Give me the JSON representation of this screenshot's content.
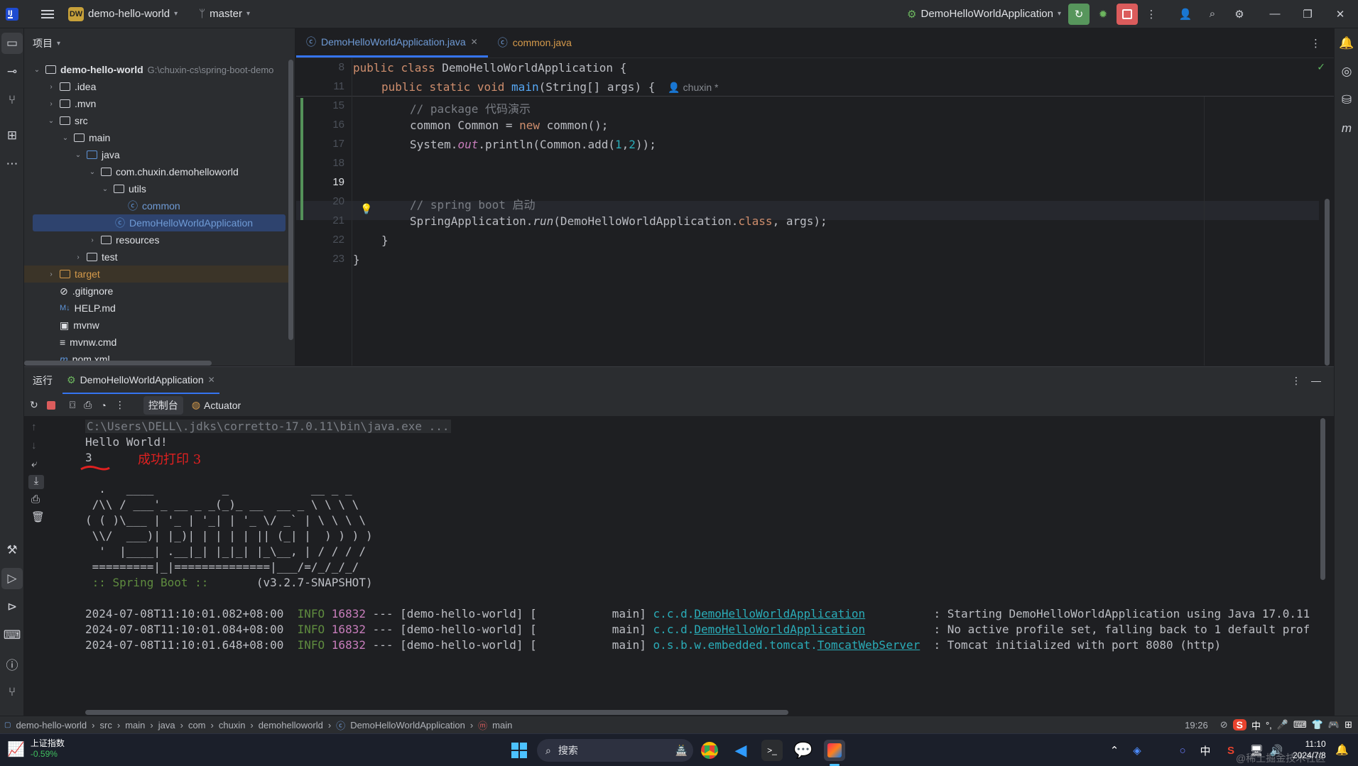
{
  "titlebar": {
    "project_badge": "DW",
    "project_name": "demo-hello-world",
    "branch": "master",
    "run_config": "DemoHelloWorldApplication"
  },
  "project_panel": {
    "title": "项目",
    "root_name": "demo-hello-world",
    "root_path": "G:\\chuxin-cs\\spring-boot-demo",
    "nodes": [
      ".idea",
      ".mvn",
      "src",
      "main",
      "java",
      "com.chuxin.demohelloworld",
      "utils",
      "common",
      "DemoHelloWorldApplication",
      "resources",
      "test",
      "target",
      ".gitignore",
      "HELP.md",
      "mvnw",
      "mvnw.cmd",
      "pom.xml"
    ]
  },
  "editor": {
    "tabs": [
      "DemoHelloWorldApplication.java",
      "common.java"
    ],
    "line_numbers": [
      "8",
      "11",
      "15",
      "16",
      "17",
      "18",
      "19",
      "20",
      "21",
      "22",
      "23"
    ],
    "lines": {
      "l8": [
        "public",
        " ",
        "class",
        " DemoHelloWorldApplication {"
      ],
      "l11": [
        "public",
        " ",
        "static",
        " ",
        "void",
        " ",
        "main",
        "(String[] args) {"
      ],
      "author": "chuxin *",
      "l15": "// package 代码演示",
      "l16": [
        "common Common = ",
        "new",
        " common();"
      ],
      "l17": [
        "System.",
        "out",
        ".println(Common.add(",
        "1",
        ",",
        "2",
        "));"
      ],
      "l19": "// spring boot 启动",
      "l20": [
        "SpringApplication.",
        "run",
        "(DemoHelloWorldApplication.",
        "class",
        ", args);"
      ],
      "l21": "}",
      "l22": "}"
    }
  },
  "run_panel": {
    "title": "运行",
    "config_tab": "DemoHelloWorldApplication",
    "tool_tabs": [
      "控制台",
      "Actuator"
    ],
    "console": {
      "cmd": "C:\\Users\\DELL\\.jdks\\corretto-17.0.11\\bin\\java.exe ...",
      "hello": "Hello World!",
      "three": "3",
      "annotation": "成功打印 3",
      "banner": [
        "  .   ____          _            __ _ _",
        " /\\\\ / ___'_ __ _ _(_)_ __  __ _ \\ \\ \\ \\",
        "( ( )\\___ | '_ | '_| | '_ \\/ _` | \\ \\ \\ \\",
        " \\\\/  ___)| |_)| | | | | || (_| |  ) ) ) )",
        "  '  |____| .__|_| |_|_| |_\\__, | / / / /",
        " =========|_|==============|___/=/_/_/_/"
      ],
      "spring_label": " :: Spring Boot ::",
      "spring_version": "       (v3.2.7-SNAPSHOT)",
      "logs": [
        {
          "ts": "2024-07-08T11:10:01.082+08:00",
          "level": "INFO",
          "pid": "16832",
          "mid": " --- [demo-hello-world] [           main] ",
          "pkg": "c.c.d.",
          "cls": "DemoHelloWorldApplication",
          "msg": ": Starting DemoHelloWorldApplication using Java 17.0.11"
        },
        {
          "ts": "2024-07-08T11:10:01.084+08:00",
          "level": "INFO",
          "pid": "16832",
          "mid": " --- [demo-hello-world] [           main] ",
          "pkg": "c.c.d.",
          "cls": "DemoHelloWorldApplication",
          "msg": ": No active profile set, falling back to 1 default prof"
        },
        {
          "ts": "2024-07-08T11:10:01.648+08:00",
          "level": "INFO",
          "pid": "16832",
          "mid": " --- [demo-hello-world] [           main] ",
          "pkg": "o.s.b.w.embedded.tomcat.",
          "cls": "TomcatWebServer",
          "msg": ": Tomcat initialized with port 8080 (http)"
        }
      ]
    }
  },
  "statusbar": {
    "crumbs": [
      "demo-hello-world",
      "src",
      "main",
      "java",
      "com",
      "chuxin",
      "demohelloworld",
      "DemoHelloWorldApplication",
      "main"
    ],
    "position": "19:26",
    "ime": "中"
  },
  "taskbar": {
    "stock_name": "上证指数",
    "stock_change": "-0.59%",
    "search_label": "搜索",
    "ime": "中",
    "time": "11:10",
    "date": "2024/7/8",
    "watermark": "@稀土掘金技术社区"
  },
  "colors": {
    "accent": "#3574f0",
    "annotation_red": "#e02020",
    "run_green": "#57965c",
    "stop_red": "#db5c5c"
  }
}
